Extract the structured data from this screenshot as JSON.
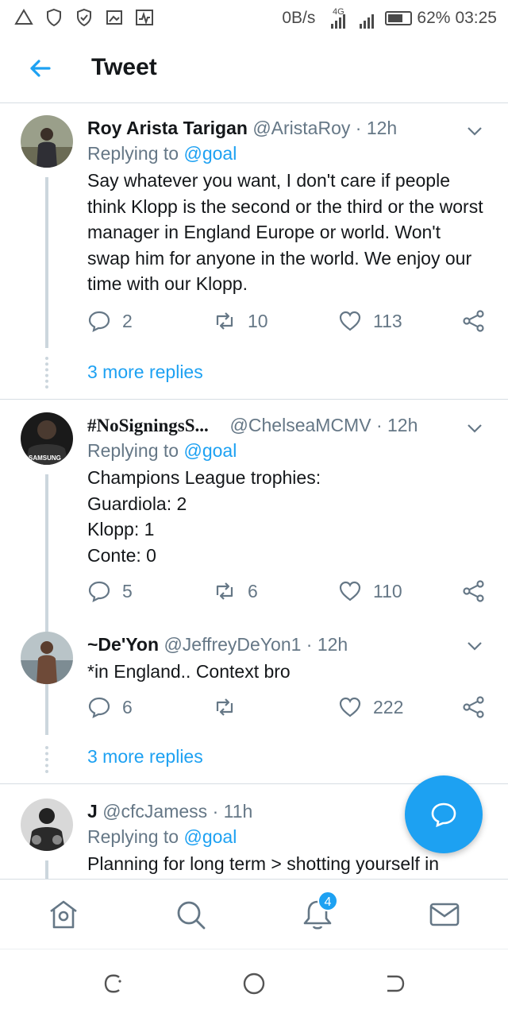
{
  "status_bar": {
    "net_speed": "0B/s",
    "network_type": "4G",
    "battery": "62%",
    "time": "03:25",
    "icons": [
      "alert-triangle-icon",
      "shield-icon",
      "shield-check-icon",
      "photo-icon",
      "activity-icon"
    ]
  },
  "header": {
    "title": "Tweet",
    "back_icon": "back-arrow-icon"
  },
  "tweets": [
    {
      "name": "Roy Arista Tarigan",
      "handle": "@AristaRoy",
      "time": "· 12h",
      "replying_prefix": "Replying to",
      "replying_handle": "@goal",
      "text": "Say whatever you want, I don't care if people think Klopp is the second or the third or the worst manager in England Europe or world. Won't swap him for anyone in the world. We enjoy our time with our Klopp.",
      "replies": "2",
      "retweets": "10",
      "likes": "113",
      "more_replies": "3 more replies"
    },
    {
      "name": "#NoSigningsS...",
      "handle": "@ChelseaMCMV",
      "time": "· 12h",
      "replying_prefix": "Replying to",
      "replying_handle": "@goal",
      "text": "Champions League trophies:\nGuardiola: 2\nKlopp: 1\nConte: 0",
      "replies": "5",
      "retweets": "6",
      "likes": "110",
      "avatar_text": "SAMSUNG"
    },
    {
      "name": "~De'Yon",
      "handle": "@JeffreyDeYon1",
      "time": "· 12h",
      "text": "*in England.. Context bro",
      "replies": "6",
      "retweets": "",
      "likes": "222",
      "more_replies": "3 more replies"
    },
    {
      "name": "J",
      "handle": "@cfcJamess",
      "time": "· 11h",
      "replying_prefix": "Replying to",
      "replying_handle": "@goal",
      "text": "Planning for long term > shotting yourself in"
    }
  ],
  "bottom_nav": {
    "items": [
      "home-icon",
      "search-icon",
      "notifications-icon",
      "messages-icon"
    ],
    "notification_badge": "4"
  },
  "colors": {
    "accent": "#1da1f2",
    "text": "#14171a",
    "secondary": "#657786",
    "divider": "#d6dde3"
  }
}
